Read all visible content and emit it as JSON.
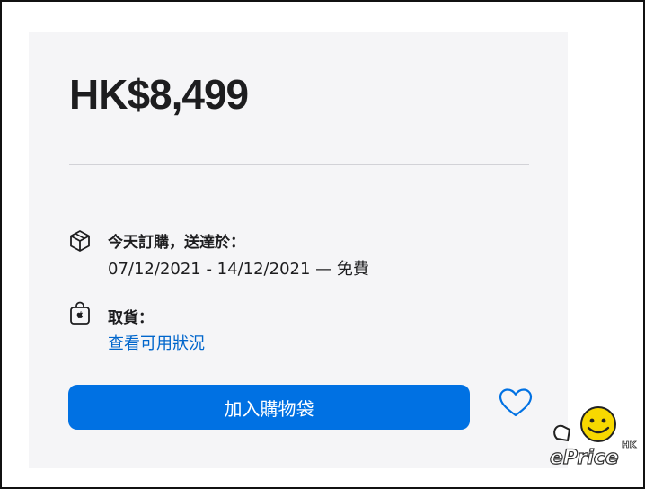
{
  "product": {
    "price": "HK$8,499"
  },
  "shipping": {
    "icon": "box-icon",
    "title": "今天訂購，送達於：",
    "dates": "07/12/2021 - 14/12/2021 — 免費"
  },
  "pickup": {
    "icon": "apple-bag-icon",
    "title": "取貨：",
    "link_label": "查看可用狀況"
  },
  "actions": {
    "add_to_bag_label": "加入購物袋",
    "favorite_icon": "heart-icon"
  },
  "watermark": {
    "brand": "ePrice",
    "region": "HK"
  },
  "colors": {
    "accent": "#0071e3",
    "link": "#0066cc",
    "panel": "#f5f5f7",
    "text": "#1d1d1f"
  }
}
